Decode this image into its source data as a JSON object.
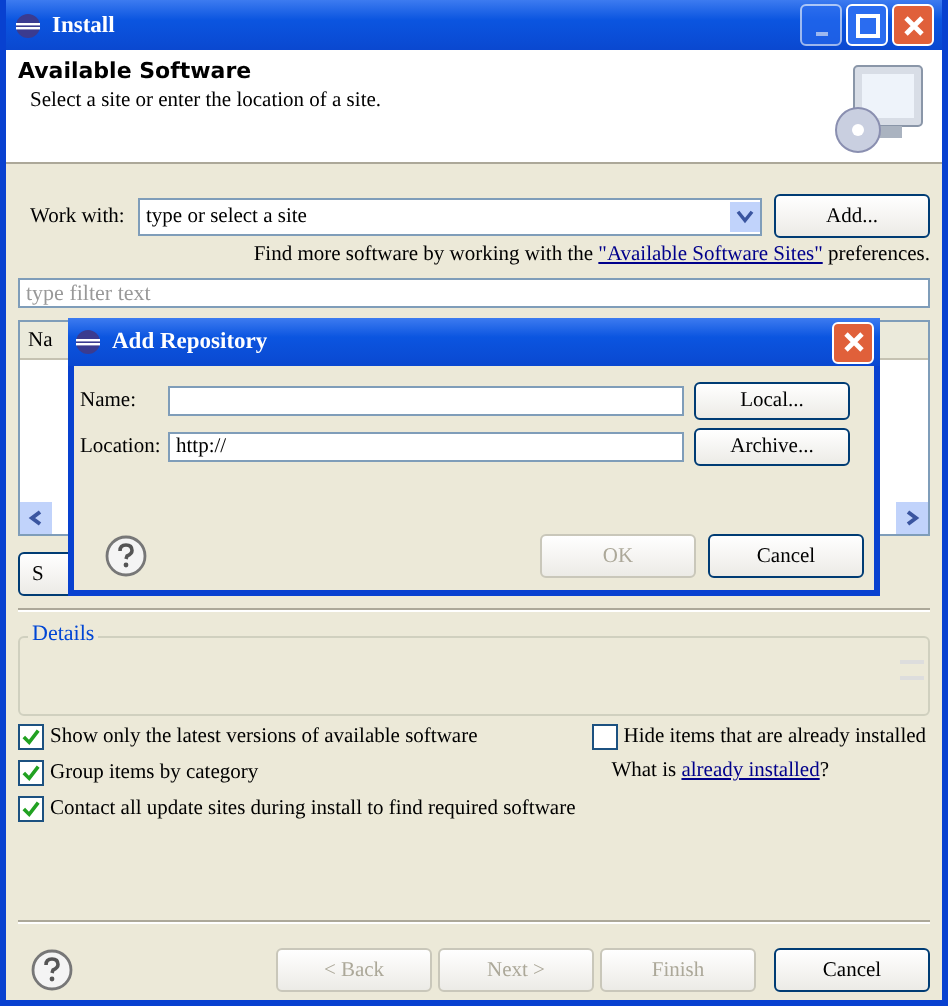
{
  "window": {
    "title": "Install"
  },
  "header": {
    "title": "Available Software",
    "subtitle": "Select a site or enter the location of a site."
  },
  "work_with": {
    "label": "Work with:",
    "value": "type or select a site",
    "button": "Add..."
  },
  "find_more": {
    "before": "Find more software by working with the ",
    "link": "\"Available Software Sites\"",
    "after": " preferences."
  },
  "filter": {
    "placeholder": "type filter text"
  },
  "table": {
    "columns": [
      "Na"
    ]
  },
  "table_buttons": [
    "S"
  ],
  "details": {
    "label": "Details"
  },
  "options_left": [
    {
      "label": "Show only the latest versions of available software",
      "checked": true
    },
    {
      "label": "Group items by category",
      "checked": true
    },
    {
      "label": "Contact all update sites during install to find required software",
      "checked": true
    }
  ],
  "options_right": [
    {
      "label": "Hide items that are already installed",
      "checked": false
    }
  ],
  "installed_note": {
    "before": "What is ",
    "link": "already installed",
    "after": "?"
  },
  "footer": {
    "buttons": [
      {
        "label": "< Back",
        "disabled": true
      },
      {
        "label": "Next >",
        "disabled": true
      },
      {
        "label": "Finish",
        "disabled": true
      },
      {
        "label": "Cancel",
        "disabled": false
      }
    ]
  },
  "dialog": {
    "title": "Add Repository",
    "fields": [
      {
        "label": "Name:",
        "button": "Local..."
      },
      {
        "label": "Location:",
        "value": "http://",
        "button": "Archive..."
      }
    ],
    "buttons": [
      {
        "label": "OK",
        "disabled": true
      },
      {
        "label": "Cancel",
        "disabled": false
      }
    ]
  }
}
